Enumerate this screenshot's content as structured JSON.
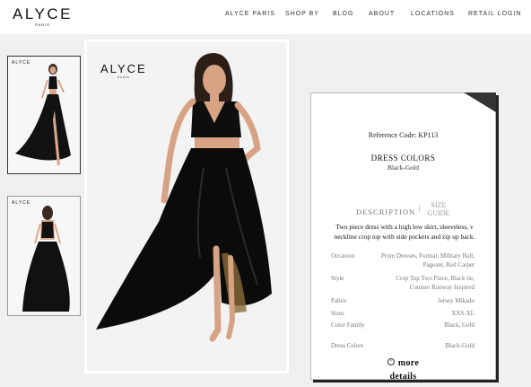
{
  "brand": {
    "name": "ALYCE",
    "tagline": "PARIS"
  },
  "nav": [
    {
      "label": "ALYCE PARIS"
    },
    {
      "label": "SHOP BY"
    },
    {
      "label": "BLOG"
    },
    {
      "label": "ABOUT"
    },
    {
      "label": "LOCATIONS"
    },
    {
      "label": "RETAIL LOGIN"
    }
  ],
  "gallery": {
    "thumb_logo": "ALYCE",
    "main_logo": {
      "name": "ALYCE",
      "tagline": "PARIS"
    }
  },
  "product": {
    "reference_code": "Reference Code: KP113",
    "colors_title": "DRESS COLORS",
    "colors_value": "Black-Gold",
    "tab_description": "DESCRIPTION",
    "tab_separator": "|",
    "tab_size_line1": "SIZE",
    "tab_size_line2": "GUIDE",
    "description": "Two piece dress with a high low skirt, sleeveless, v neckline crop top with side pockets and zip up back.",
    "specs": [
      {
        "key": "Occasion",
        "value": "Prom Dresses, Formal, Military Ball, Pageant, Red Carpet"
      },
      {
        "key": "Style",
        "value": "Crop Top Two Piece, Black tie, Couture Runway Inspired"
      },
      {
        "key": "Fabric",
        "value": "Jersey Mikado"
      },
      {
        "key": "Sizes",
        "value": "XXS-XL"
      },
      {
        "key": "Color Family",
        "value": "Black, Gold"
      },
      {
        "key": "Dress Colors",
        "value": "Black-Gold"
      }
    ],
    "more_line1": "more",
    "more_line2": "details",
    "more_icon": "plus-circle-icon"
  }
}
